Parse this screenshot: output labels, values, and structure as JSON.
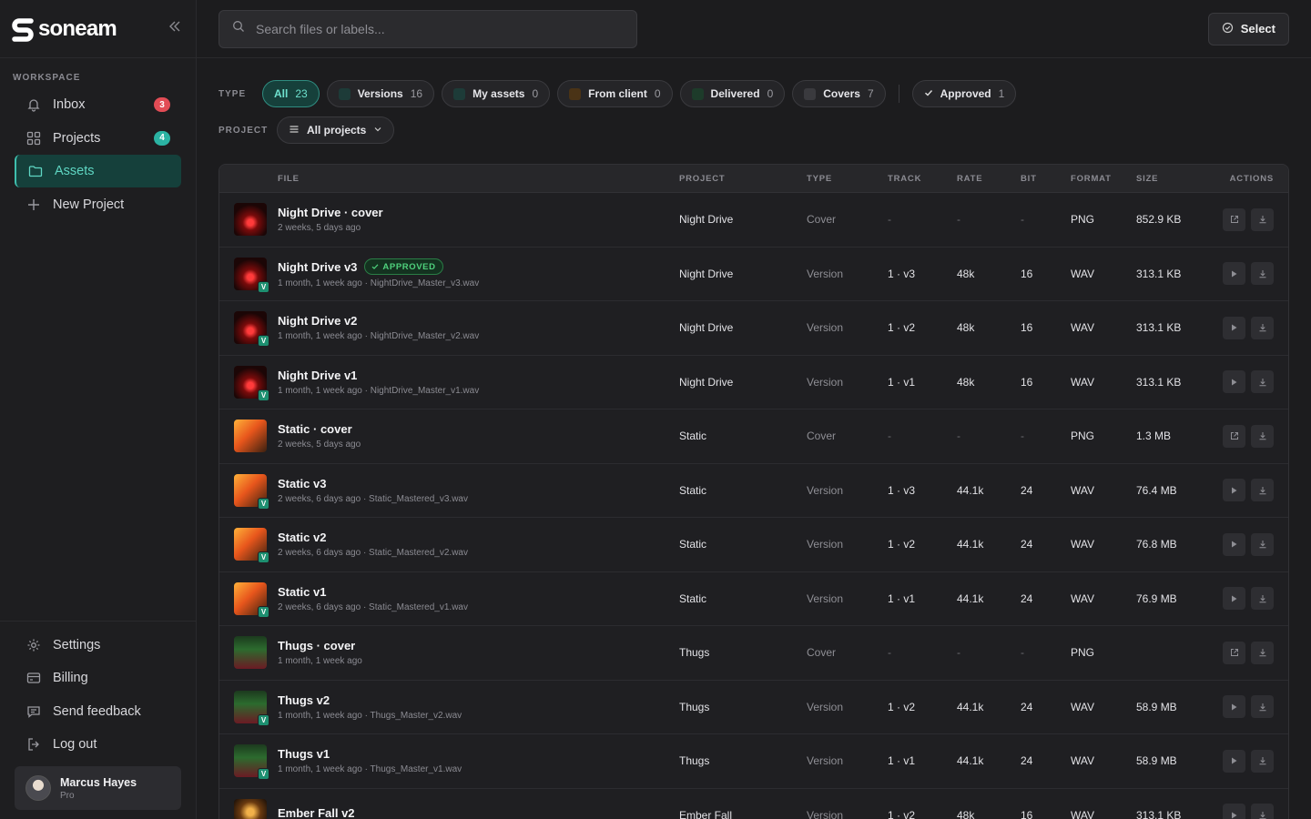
{
  "brand": {
    "name": "soneam"
  },
  "sidebar": {
    "section_label": "WORKSPACE",
    "items": [
      {
        "label": "Inbox",
        "icon": "bell-icon",
        "badge": "3"
      },
      {
        "label": "Projects",
        "icon": "grid-icon",
        "badge": "4"
      },
      {
        "label": "Assets",
        "icon": "folder-icon",
        "active": true
      },
      {
        "label": "New Project",
        "icon": "plus-icon"
      }
    ],
    "bottom_items": [
      {
        "label": "Settings",
        "icon": "gear-icon"
      },
      {
        "label": "Billing",
        "icon": "card-icon"
      },
      {
        "label": "Send feedback",
        "icon": "message-icon"
      },
      {
        "label": "Log out",
        "icon": "logout-icon"
      }
    ],
    "user": {
      "name": "Marcus Hayes",
      "plan": "Pro"
    }
  },
  "topbar": {
    "search_placeholder": "Search files or labels...",
    "select_label": "Select"
  },
  "filters": {
    "type_label": "TYPE",
    "chips": [
      {
        "label": "All",
        "count": "23",
        "active": true
      },
      {
        "label": "Versions",
        "count": "16",
        "color": "#1d3b38"
      },
      {
        "label": "My assets",
        "count": "0",
        "color": "#1d3b38"
      },
      {
        "label": "From client",
        "count": "0",
        "color": "#4a3316"
      },
      {
        "label": "Delivered",
        "count": "0",
        "color": "#1d3b2a"
      },
      {
        "label": "Covers",
        "count": "7",
        "color": "#3a3a3e"
      }
    ],
    "approved": {
      "label": "Approved",
      "count": "1"
    },
    "project_label": "PROJECT",
    "project_value": "All projects"
  },
  "table": {
    "headers": {
      "file": "FILE",
      "project": "PROJECT",
      "type": "TYPE",
      "track": "TRACK",
      "rate": "RATE",
      "bit": "BIT",
      "format": "FORMAT",
      "size": "SIZE",
      "actions": "ACTIONS"
    },
    "approved_label": "APPROVED",
    "rows": [
      {
        "name": "Night Drive · cover",
        "sub": "2 weeks, 5 days ago",
        "project": "Night Drive",
        "type": "Cover",
        "track": "-",
        "rate": "-",
        "bit": "-",
        "format": "PNG",
        "size": "852.9 KB",
        "thumb": "night",
        "version": false,
        "approved": false,
        "action": "open"
      },
      {
        "name": "Night Drive v3",
        "sub": "1 month, 1 week ago · NightDrive_Master_v3.wav",
        "project": "Night Drive",
        "type": "Version",
        "track": "1 · v3",
        "rate": "48k",
        "bit": "16",
        "format": "WAV",
        "size": "313.1 KB",
        "thumb": "night",
        "version": true,
        "approved": true,
        "action": "play"
      },
      {
        "name": "Night Drive v2",
        "sub": "1 month, 1 week ago · NightDrive_Master_v2.wav",
        "project": "Night Drive",
        "type": "Version",
        "track": "1 · v2",
        "rate": "48k",
        "bit": "16",
        "format": "WAV",
        "size": "313.1 KB",
        "thumb": "night",
        "version": true,
        "approved": false,
        "action": "play"
      },
      {
        "name": "Night Drive v1",
        "sub": "1 month, 1 week ago · NightDrive_Master_v1.wav",
        "project": "Night Drive",
        "type": "Version",
        "track": "1 · v1",
        "rate": "48k",
        "bit": "16",
        "format": "WAV",
        "size": "313.1 KB",
        "thumb": "night",
        "version": true,
        "approved": false,
        "action": "play"
      },
      {
        "name": "Static · cover",
        "sub": "2 weeks, 5 days ago",
        "project": "Static",
        "type": "Cover",
        "track": "-",
        "rate": "-",
        "bit": "-",
        "format": "PNG",
        "size": "1.3 MB",
        "thumb": "static",
        "version": false,
        "approved": false,
        "action": "open"
      },
      {
        "name": "Static v3",
        "sub": "2 weeks, 6 days ago · Static_Mastered_v3.wav",
        "project": "Static",
        "type": "Version",
        "track": "1 · v3",
        "rate": "44.1k",
        "bit": "24",
        "format": "WAV",
        "size": "76.4 MB",
        "thumb": "static",
        "version": true,
        "approved": false,
        "action": "play"
      },
      {
        "name": "Static v2",
        "sub": "2 weeks, 6 days ago · Static_Mastered_v2.wav",
        "project": "Static",
        "type": "Version",
        "track": "1 · v2",
        "rate": "44.1k",
        "bit": "24",
        "format": "WAV",
        "size": "76.8 MB",
        "thumb": "static",
        "version": true,
        "approved": false,
        "action": "play"
      },
      {
        "name": "Static v1",
        "sub": "2 weeks, 6 days ago · Static_Mastered_v1.wav",
        "project": "Static",
        "type": "Version",
        "track": "1 · v1",
        "rate": "44.1k",
        "bit": "24",
        "format": "WAV",
        "size": "76.9 MB",
        "thumb": "static",
        "version": true,
        "approved": false,
        "action": "play"
      },
      {
        "name": "Thugs · cover",
        "sub": "1 month, 1 week ago",
        "project": "Thugs",
        "type": "Cover",
        "track": "-",
        "rate": "-",
        "bit": "-",
        "format": "PNG",
        "size": "",
        "thumb": "thugs",
        "version": false,
        "approved": false,
        "action": "open"
      },
      {
        "name": "Thugs v2",
        "sub": "1 month, 1 week ago · Thugs_Master_v2.wav",
        "project": "Thugs",
        "type": "Version",
        "track": "1 · v2",
        "rate": "44.1k",
        "bit": "24",
        "format": "WAV",
        "size": "58.9 MB",
        "thumb": "thugs",
        "version": true,
        "approved": false,
        "action": "play"
      },
      {
        "name": "Thugs v1",
        "sub": "1 month, 1 week ago · Thugs_Master_v1.wav",
        "project": "Thugs",
        "type": "Version",
        "track": "1 · v1",
        "rate": "44.1k",
        "bit": "24",
        "format": "WAV",
        "size": "58.9 MB",
        "thumb": "thugs",
        "version": true,
        "approved": false,
        "action": "play"
      },
      {
        "name": "Ember Fall v2",
        "sub": "",
        "project": "Ember Fall",
        "type": "Version",
        "track": "1 · v2",
        "rate": "48k",
        "bit": "16",
        "format": "WAV",
        "size": "313.1 KB",
        "thumb": "ember",
        "version": true,
        "approved": false,
        "action": "play"
      }
    ]
  }
}
